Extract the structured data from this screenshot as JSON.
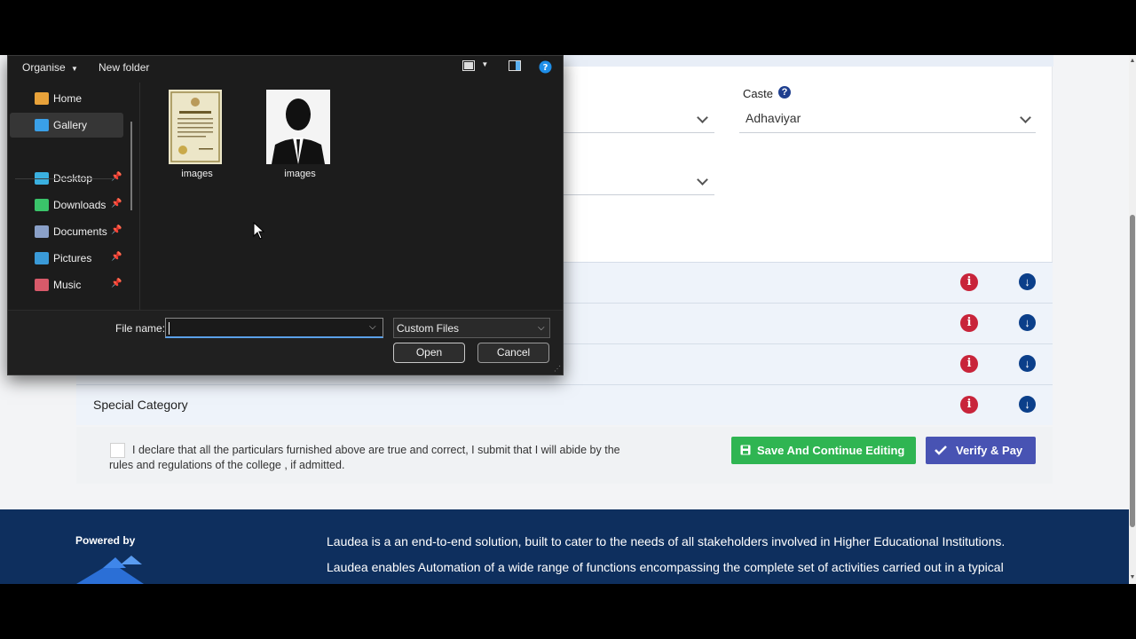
{
  "form": {
    "caste_label": "Caste",
    "caste_help": "?",
    "caste_value": "Adhaviyar"
  },
  "accordion": {
    "rows": [
      {
        "title": ""
      },
      {
        "title": ""
      },
      {
        "title": ""
      },
      {
        "title": "Special Category"
      }
    ],
    "info_glyph": "i",
    "down_glyph": "↓"
  },
  "declaration": {
    "text": "I declare that all the particulars furnished above are true and correct, I submit that I will abide by the rules and regulations of the college , if admitted.",
    "save_label": "Save And Continue Editing",
    "verify_label": "Verify & Pay"
  },
  "footer": {
    "powered_by": "Powered by",
    "para1": "Laudea is a an end-to-end solution, built to cater to the needs of all stakeholders involved in Higher Educational Institutions.",
    "para2": "Laudea enables Automation of a wide range of functions encompassing the complete set of activities carried out in a typical"
  },
  "dialog": {
    "toolbar": {
      "organise": "Organise",
      "new_folder": "New folder"
    },
    "nav": [
      {
        "label": "Home",
        "icon": "home-icon",
        "color": "#e8a23a",
        "pinned": false,
        "selected": false
      },
      {
        "label": "Gallery",
        "icon": "gallery-icon",
        "color": "#3aa0e8",
        "pinned": false,
        "selected": true
      },
      {
        "label": "Desktop",
        "icon": "desktop-icon",
        "color": "#3ab0e0",
        "pinned": true,
        "selected": false
      },
      {
        "label": "Downloads",
        "icon": "downloads-icon",
        "color": "#3ac46a",
        "pinned": true,
        "selected": false
      },
      {
        "label": "Documents",
        "icon": "documents-icon",
        "color": "#8aa0c8",
        "pinned": true,
        "selected": false
      },
      {
        "label": "Pictures",
        "icon": "pictures-icon",
        "color": "#3a9ad8",
        "pinned": true,
        "selected": false
      },
      {
        "label": "Music",
        "icon": "music-icon",
        "color": "#d85a6a",
        "pinned": true,
        "selected": false
      }
    ],
    "files": [
      {
        "name": "images",
        "kind": "certificate-thumbnail"
      },
      {
        "name": "images",
        "kind": "person-silhouette-thumbnail"
      }
    ],
    "file_name_label": "File name:",
    "file_name_value": "",
    "file_type": "Custom Files",
    "open_label": "Open",
    "cancel_label": "Cancel",
    "pin_glyph": "📌"
  }
}
